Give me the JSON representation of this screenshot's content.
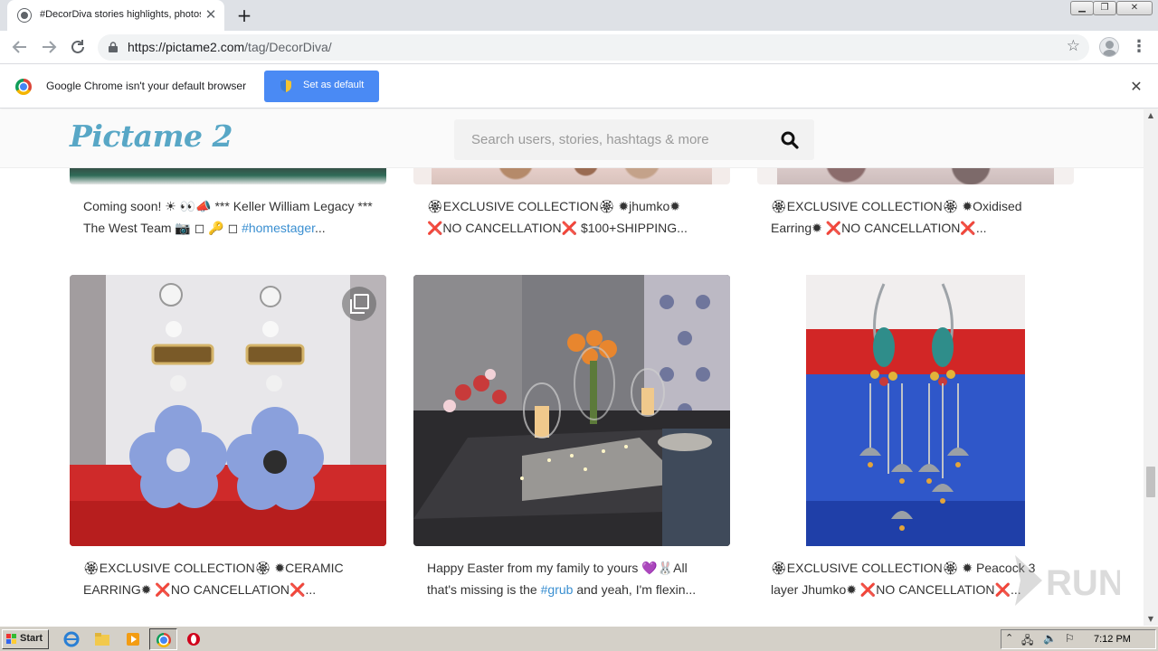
{
  "browser": {
    "tab_title": "#DecorDiva stories highlights, photos",
    "tab_close_glyph": "✕",
    "new_tab_glyph": "+",
    "url_domain": "https://pictame2.com",
    "url_path": "/tag/DecorDiva/",
    "infobar_text": "Google Chrome isn't your default browser",
    "set_default_label": "Set as default"
  },
  "site": {
    "logo": "Pictame 2",
    "search_placeholder": "Search users, stories, hashtags & more"
  },
  "posts_top": [
    {
      "caption_pre": "Coming soon! ☀ 👀📣 *** Keller William Legacy *** The West Team 📷 ◻ 🔑 ◻ ",
      "hashtag": "#homestager",
      "caption_post": "..."
    },
    {
      "caption_pre": "🏵EXCLUSIVE COLLECTION🏵 ✹jhumko✹ ❌NO CANCELLATION❌ $100+SHIPPING...",
      "hashtag": "",
      "caption_post": ""
    },
    {
      "caption_pre": "🏵EXCLUSIVE COLLECTION🏵 ✹Oxidised Earring✹ ❌NO CANCELLATION❌...",
      "hashtag": "",
      "caption_post": ""
    }
  ],
  "posts_bottom": [
    {
      "caption_pre": "🏵EXCLUSIVE COLLECTION🏵 ✹CERAMIC EARRING✹ ❌NO CANCELLATION❌...",
      "hashtag": "",
      "caption_post": ""
    },
    {
      "caption_pre": "Happy Easter from my family to yours 💜🐰All that's missing is the ",
      "hashtag": "#grub",
      "caption_post": " and yeah, I'm flexin..."
    },
    {
      "caption_pre": "🏵EXCLUSIVE COLLECTION🏵 ✹ Peacock 3 layer Jhumko✹ ❌NO CANCELLATION❌...",
      "hashtag": "",
      "caption_post": ""
    }
  ],
  "taskbar": {
    "start_label": "Start",
    "clock": "7:12 PM"
  },
  "watermark_text": "ANY.RUN",
  "colors": {
    "logo": "#58a7c6",
    "hashtag": "#3a8fd1",
    "button_blue": "#4a8af4",
    "tabstrip": "#dee1e6"
  }
}
